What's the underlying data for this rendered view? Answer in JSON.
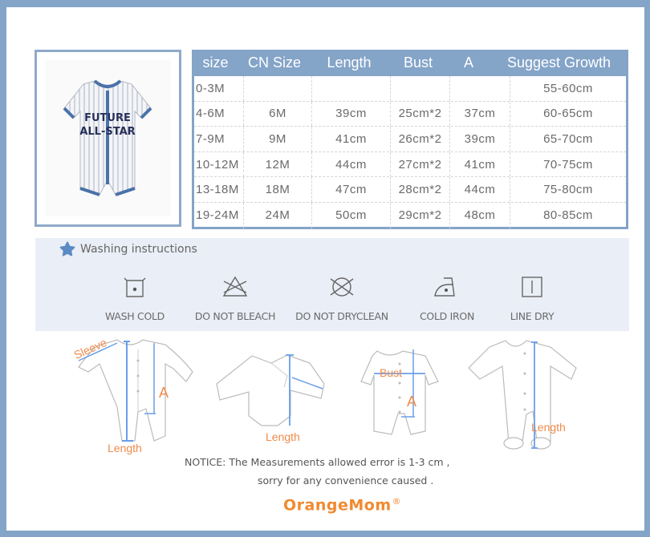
{
  "product": {
    "image_alt": "Baby striped short-sleeve romper",
    "print_line1": "FUTURE",
    "print_line2": "ALL-STAR"
  },
  "size_table": {
    "headers": [
      "size",
      "CN Size",
      "Length",
      "Bust",
      "A",
      "Suggest Growth"
    ],
    "rows": [
      {
        "size": "0-3M",
        "cn_size": "",
        "length": "",
        "bust": "",
        "a": "",
        "growth": "55-60cm"
      },
      {
        "size": "4-6M",
        "cn_size": "6M",
        "length": "39cm",
        "bust": "25cm*2",
        "a": "37cm",
        "growth": "60-65cm"
      },
      {
        "size": "7-9M",
        "cn_size": "9M",
        "length": "41cm",
        "bust": "26cm*2",
        "a": "39cm",
        "growth": "65-70cm"
      },
      {
        "size": "10-12M",
        "cn_size": "12M",
        "length": "44cm",
        "bust": "27cm*2",
        "a": "41cm",
        "growth": "70-75cm"
      },
      {
        "size": "13-18M",
        "cn_size": "18M",
        "length": "47cm",
        "bust": "28cm*2",
        "a": "44cm",
        "growth": "75-80cm"
      },
      {
        "size": "19-24M",
        "cn_size": "24M",
        "length": "50cm",
        "bust": "29cm*2",
        "a": "48cm",
        "growth": "80-85cm"
      }
    ]
  },
  "washing": {
    "title": "Washing instructions",
    "title_icon": "star-icon",
    "items": [
      {
        "icon": "wash-cold-icon",
        "label": "WASH COLD"
      },
      {
        "icon": "do-not-bleach-icon",
        "label": "DO NOT BLEACH"
      },
      {
        "icon": "do-not-dryclean-icon",
        "label": "DO NOT DRYCLEAN"
      },
      {
        "icon": "cold-iron-icon",
        "label": "COLD IRON"
      },
      {
        "icon": "line-dry-icon",
        "label": "LINE DRY"
      }
    ]
  },
  "diagrams": {
    "jumpsuit_long": {
      "sleeve": "Sleeve",
      "a": "A",
      "length": "Length"
    },
    "bodysuit": {
      "length": "Length"
    },
    "romper_short": {
      "bust": "Bust",
      "a": "A"
    },
    "footed_sleeper": {
      "length": "Length"
    }
  },
  "notice": {
    "line1": "NOTICE:   The Measurements allowed error is 1-3 cm ,",
    "line2": "sorry for any convenience caused ."
  },
  "brand": {
    "name": "OrangeMom",
    "mark": "®"
  },
  "colors": {
    "frame_blue": "#84a4c8",
    "measure_blue": "#6a9ee8",
    "measure_orange": "#f08a4b",
    "brand_orange": "#f08a30"
  }
}
